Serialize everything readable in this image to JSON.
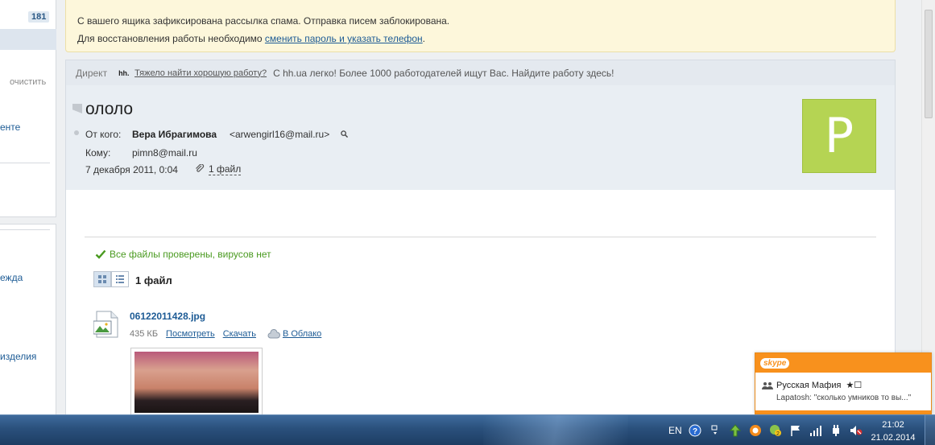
{
  "sidebar": {
    "unread_count": "181",
    "clear_label": "очистить",
    "links": [
      "енте",
      "ежда",
      "изделия"
    ]
  },
  "warning": {
    "line1": "С вашего ящика зафиксирована рассылка спама. Отправка писем заблокирована.",
    "line2_prefix": "Для восстановления работы необходимо ",
    "line2_link": "сменить пароль и указать телефон",
    "line2_suffix": "."
  },
  "ad": {
    "label": "Директ",
    "logo": "hh.",
    "link": "Тяжело найти хорошую работу?",
    "text": "С hh.ua легко! Более 1000 работодателей ищут Вас. Найдите работу здесь!"
  },
  "message": {
    "subject": "ололо",
    "from_label": "От кого:",
    "from_name": "Вера Ибрагимова",
    "from_email": "<arwengirl16@mail.ru>",
    "to_label": "Кому:",
    "to_value": "pimn8@mail.ru",
    "date": "7 декабря 2011, 0:04",
    "attachments_link": "1 файл",
    "avatar_letter": "P",
    "avatar_color": "#b5d453"
  },
  "attachments": {
    "virus_status": "Все файлы проверены, вирусов нет",
    "count_label": "1 файл",
    "file": {
      "name": "06122011428.jpg",
      "size": "435 КБ",
      "view_label": "Посмотреть",
      "download_label": "Скачать",
      "cloud_label": "В Облако"
    }
  },
  "skype": {
    "logo": "skype",
    "group": "Русская Мафия",
    "group_marks": "★☐",
    "message": "Lapatosh: \"сколько умников то вы...\""
  },
  "taskbar": {
    "lang": "EN",
    "time": "21:02",
    "date": "21.02.2014"
  },
  "colors": {
    "link": "#1d5b95",
    "warning_bg": "#fdf7db",
    "success": "#4a9a20",
    "skype_orange": "#f8911d"
  }
}
